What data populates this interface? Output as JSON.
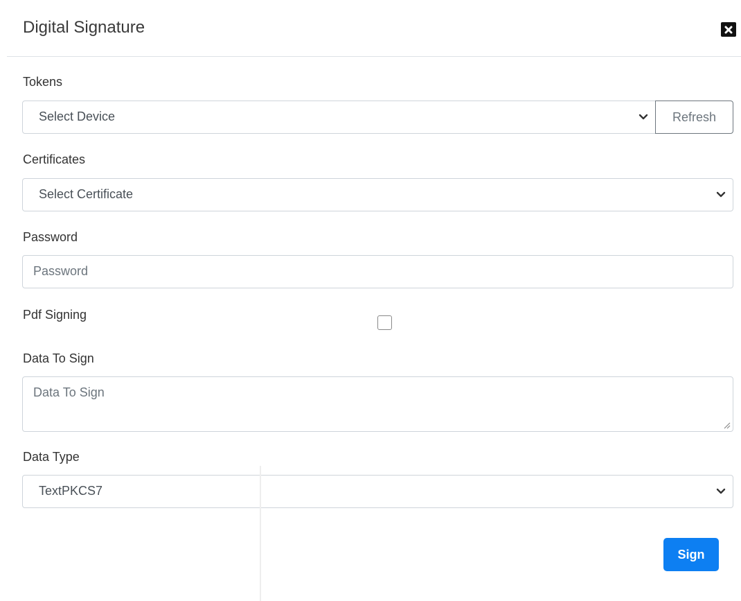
{
  "dialog": {
    "title": "Digital Signature",
    "close_icon": "close-icon"
  },
  "tokens": {
    "label": "Tokens",
    "select_value": "Select Device",
    "refresh_label": "Refresh"
  },
  "certificates": {
    "label": "Certificates",
    "select_value": "Select Certificate"
  },
  "password": {
    "label": "Password",
    "placeholder": "Password"
  },
  "pdf_signing": {
    "label": "Pdf Signing",
    "checked": false
  },
  "data_to_sign": {
    "label": "Data To Sign",
    "placeholder": "Data To Sign"
  },
  "data_type": {
    "label": "Data Type",
    "select_value": "TextPKCS7"
  },
  "actions": {
    "sign_label": "Sign"
  },
  "colors": {
    "primary": "#0d7ff2",
    "border": "#ced4da",
    "text": "#333333"
  }
}
